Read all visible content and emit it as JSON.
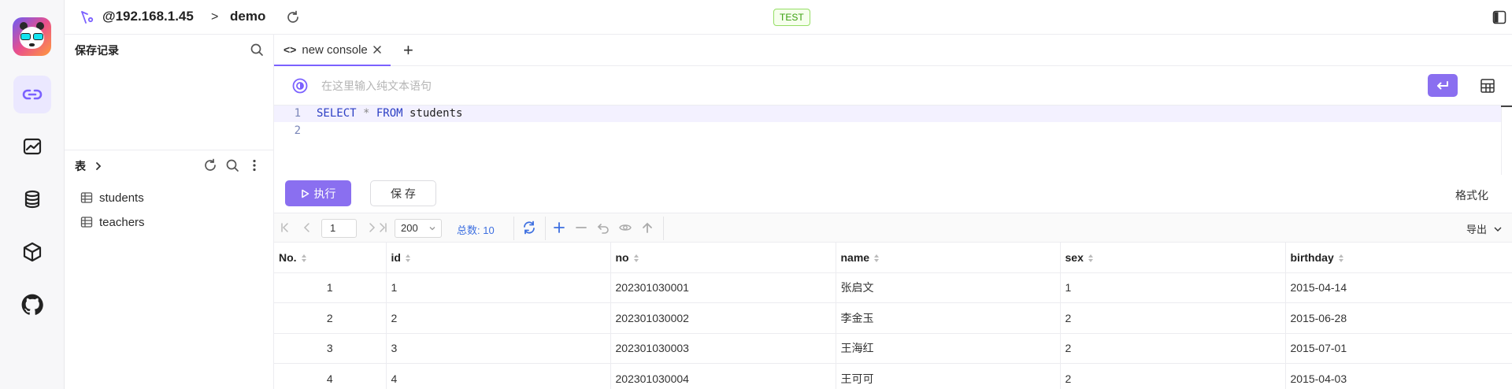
{
  "topbar": {
    "host": "@192.168.1.45",
    "separator": ">",
    "database": "demo",
    "env_badge": "TEST",
    "badge_color": "#389e0d"
  },
  "rail": {
    "items": [
      "connections-icon",
      "dashboard-icon",
      "database-icon",
      "package-icon",
      "github-icon"
    ],
    "active": "connections-icon",
    "accent": "#7b61ff"
  },
  "saved": {
    "title": "保存记录"
  },
  "tables": {
    "title": "表",
    "items": [
      {
        "label": "students"
      },
      {
        "label": "teachers"
      }
    ]
  },
  "console": {
    "tab_code_icon": "<>",
    "tab_label": "new console",
    "add_tab": "+",
    "nl_placeholder": "在这里输入纯文本语句",
    "lines": [
      {
        "no": "1",
        "kw1": "SELECT",
        "op": " * ",
        "kw2": "FROM",
        "rest": " students"
      },
      {
        "no": "2"
      }
    ]
  },
  "actions": {
    "run_label": "执行",
    "save_label": "保 存",
    "format_label": "格式化",
    "accent": "#8a6ff0"
  },
  "pager": {
    "page": "1",
    "page_size": "200",
    "total_label": "总数: 10",
    "export_label": "导出"
  },
  "grid": {
    "columns": [
      "No.",
      "id",
      "no",
      "name",
      "sex",
      "birthday"
    ],
    "rows": [
      [
        "1",
        "1",
        "202301030001",
        "张启文",
        "1",
        "2015-04-14"
      ],
      [
        "2",
        "2",
        "202301030002",
        "李金玉",
        "2",
        "2015-06-28"
      ],
      [
        "3",
        "3",
        "202301030003",
        "王海红",
        "2",
        "2015-07-01"
      ],
      [
        "4",
        "4",
        "202301030004",
        "王可可",
        "2",
        "2015-04-03"
      ]
    ]
  }
}
